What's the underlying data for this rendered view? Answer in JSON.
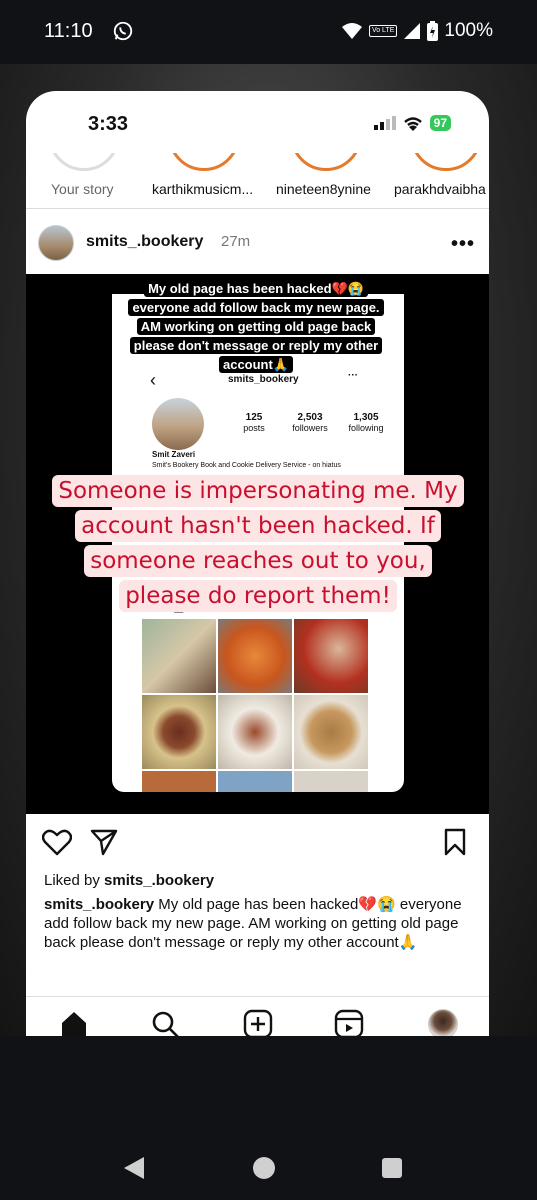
{
  "android_status": {
    "time": "11:10",
    "volte": "Vo LTE",
    "battery": "100%"
  },
  "ios_status": {
    "time": "3:33",
    "battery": "97"
  },
  "stories": [
    {
      "label": "Your story"
    },
    {
      "label": "karthikmusicm..."
    },
    {
      "label": "nineteen8ynine"
    },
    {
      "label": "parakhdvaibha"
    }
  ],
  "post": {
    "username": "smits_.bookery",
    "time": "27m",
    "overlay_top": "My old page has been hacked💔😭 everyone add follow back my new page. AM working on getting old page back please don't message or reply my other account🙏",
    "inner_profile": {
      "name": "smits_bookery",
      "posts_num": "125",
      "posts_label": "posts",
      "followers_num": "2,503",
      "followers_label": "followers",
      "following_num": "1,305",
      "following_label": "following",
      "bio_name": "Smit Zaveri",
      "bio": "Smit's Bookery Book and Cookie Delivery Service - on hiatus"
    },
    "overlay_red": "Someone is impersonating me. My account hasn't been hacked. If someone reaches out to you,  please do report them!",
    "liked_prefix": "Liked by ",
    "liked_user": "smits_.bookery",
    "caption_user": "smits_.bookery",
    "caption_text": " My old page has been hacked💔😭 everyone add follow back my new page. AM working on getting old page back please don't message or reply my other account🙏"
  },
  "colors": {
    "story_ring": "#e57a2a",
    "overlay_red_text": "#c8102e",
    "overlay_red_bg": "#fde5e5",
    "ios_battery": "#34c759"
  },
  "icons": [
    "whatsapp-icon",
    "wifi-icon",
    "signal-icon",
    "battery-icon",
    "more-icon",
    "heart-icon",
    "share-icon",
    "bookmark-icon",
    "home-icon",
    "search-icon",
    "add-post-icon",
    "reels-icon",
    "profile-avatar-icon",
    "back-chevron-icon",
    "grid-icon"
  ]
}
